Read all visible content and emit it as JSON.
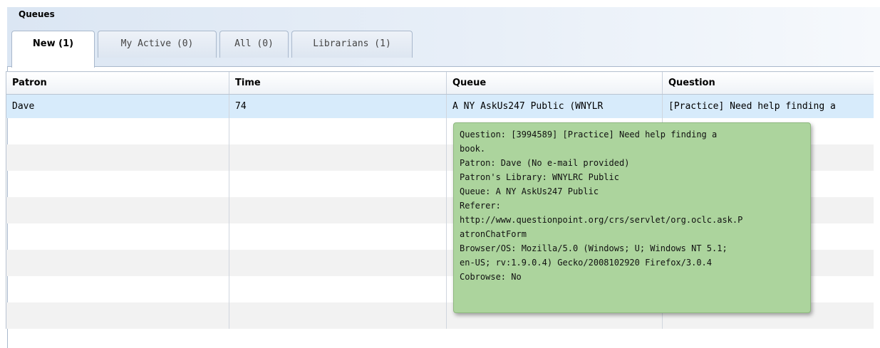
{
  "panel": {
    "title": "Queues"
  },
  "tabs": [
    {
      "label": "New (1)",
      "active": true
    },
    {
      "label": "My Active (0)",
      "active": false
    },
    {
      "label": "All (0)",
      "active": false
    },
    {
      "label": "Librarians (1)",
      "active": false
    }
  ],
  "table": {
    "columns": [
      "Patron",
      "Time",
      "Queue",
      "Question"
    ],
    "rows": [
      {
        "patron": "Dave",
        "time": "74",
        "queue": "A NY AskUs247 Public (WNYLR",
        "question": "[Practice] Need help finding a"
      }
    ]
  },
  "tooltip": {
    "lines": [
      "Question: [3994589] [Practice] Need help finding a",
      "book.",
      "Patron: Dave (No e-mail provided)",
      "Patron's Library: WNYLRC Public",
      "Queue: A NY AskUs247 Public",
      "Referer:",
      "http://www.questionpoint.org/crs/servlet/org.oclc.ask.P",
      "atronChatForm",
      "Browser/OS: Mozilla/5.0 (Windows; U; Windows NT 5.1;",
      "en-US; rv:1.9.0.4) Gecko/2008102920 Firefox/3.0.4",
      "Cobrowse: No"
    ]
  },
  "colors": {
    "header_gradient_start": "#dbe6f3",
    "selected_row": "#d7ebfb",
    "alt_row": "#f2f2f2",
    "tooltip_bg": "#acd49d"
  }
}
